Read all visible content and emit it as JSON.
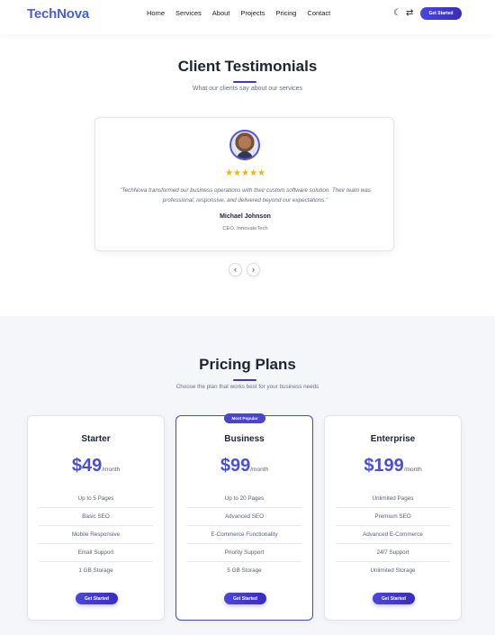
{
  "header": {
    "logo": "TechNova",
    "nav": [
      "Home",
      "Services",
      "About",
      "Projects",
      "Pricing",
      "Contact"
    ],
    "icons": [
      "moon-icon",
      "swap-icon"
    ],
    "cta_label": "Get Started"
  },
  "testimonials": {
    "title": "Client Testimonials",
    "subtitle": "What our clients say about our services",
    "rating_stars": "★★★★★",
    "rating": 5,
    "quote": "\"TechNova transformed our business operations with their custom software solution. Their team was professional, responsive, and delivered beyond our expectations.\"",
    "name": "Michael Johnson",
    "role": "CEO, InnovateTech",
    "prev_icon": "‹",
    "next_icon": "›"
  },
  "pricing": {
    "title": "Pricing Plans",
    "subtitle": "Choose the plan that works best for your business needs",
    "plans": [
      {
        "name": "Starter",
        "price": "$49",
        "period": "/month",
        "features": [
          "Up to 5 Pages",
          "Basic SEO",
          "Mobile Responsive",
          "Email Support",
          "1 GB Storage"
        ],
        "button": "Get Started"
      },
      {
        "name": "Business",
        "badge": "Most Popular",
        "price": "$99",
        "period": "/month",
        "features": [
          "Up to 20 Pages",
          "Advanced SEO",
          "E-Commerce Functionality",
          "Priority Support",
          "5 GB Storage"
        ],
        "button": "Get Started"
      },
      {
        "name": "Enterprise",
        "price": "$199",
        "period": "/month",
        "features": [
          "Unlimited Pages",
          "Premium SEO",
          "Advanced E-Commerce",
          "24/7 Support",
          "Unlimited Storage"
        ],
        "button": "Get Started"
      }
    ]
  },
  "colors": {
    "accent": "#4b4fd8",
    "star": "#f5b400",
    "section_bg": "#f5f6fa"
  }
}
